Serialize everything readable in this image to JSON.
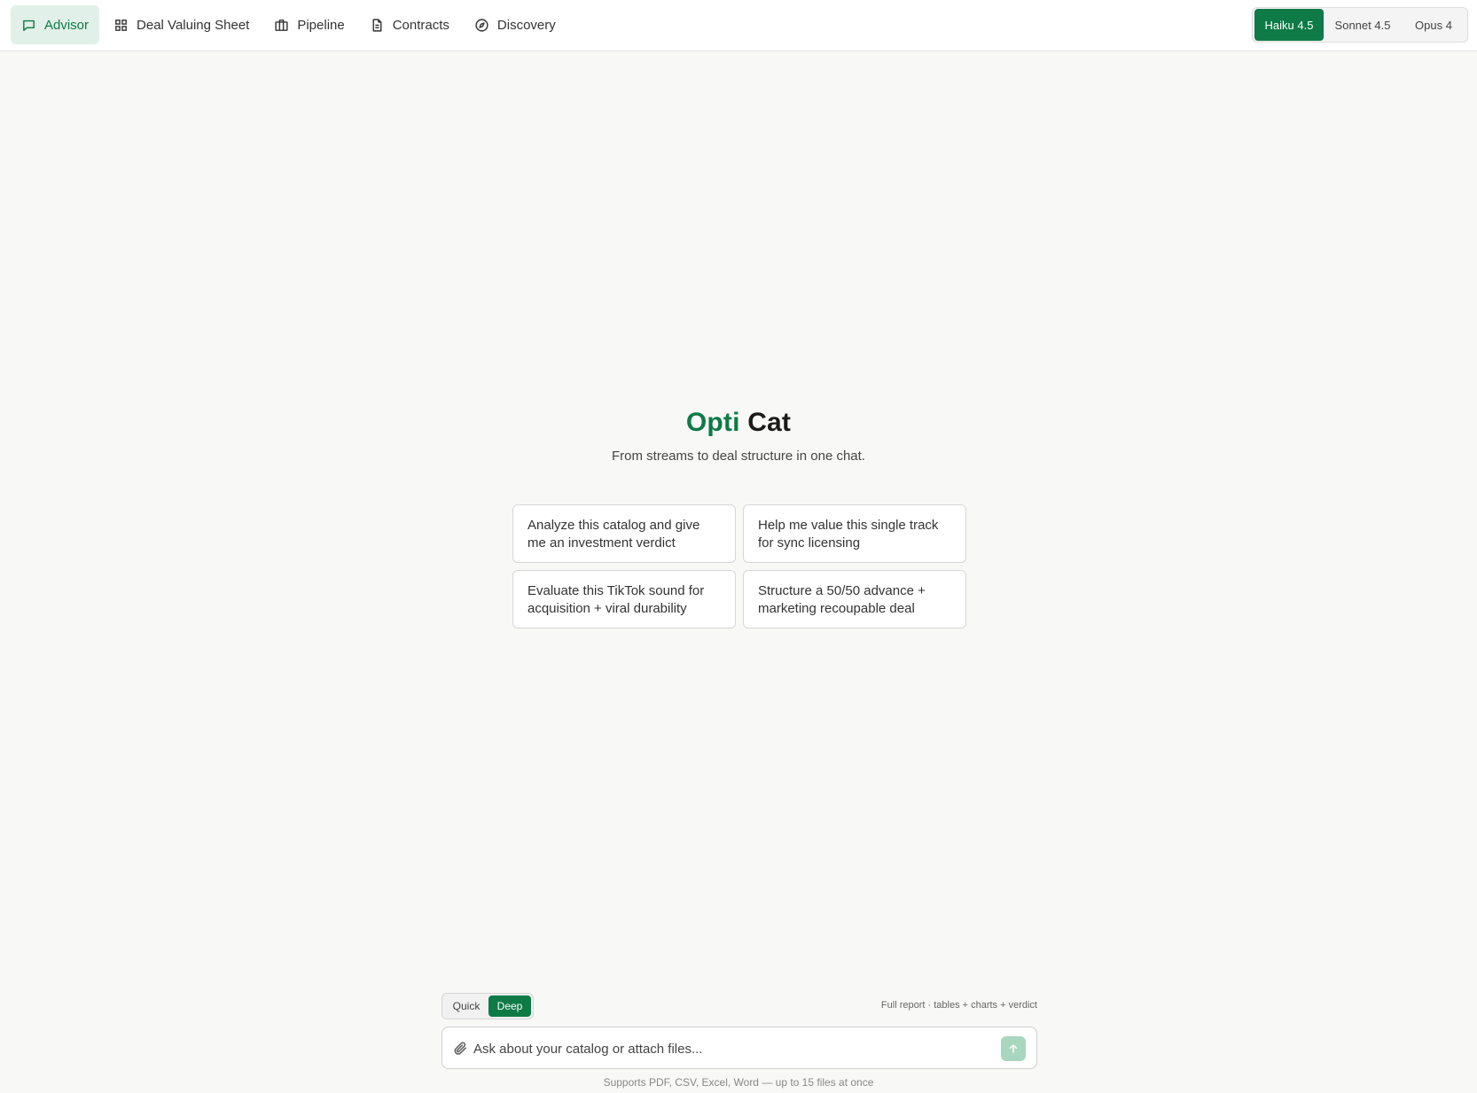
{
  "nav": {
    "items": [
      {
        "label": "Advisor",
        "icon": "chat-bubble-icon",
        "active": true
      },
      {
        "label": "Deal Valuing Sheet",
        "icon": "grid-icon"
      },
      {
        "label": "Pipeline",
        "icon": "briefcase-icon"
      },
      {
        "label": "Contracts",
        "icon": "document-icon"
      },
      {
        "label": "Discovery",
        "icon": "compass-icon"
      }
    ]
  },
  "models": {
    "options": [
      "Haiku 4.5",
      "Sonnet 4.5",
      "Opus 4"
    ],
    "selected": "Haiku 4.5"
  },
  "hero": {
    "brand_part1": "Opti",
    "brand_part2": "Cat",
    "tagline": "From streams to deal structure in one chat."
  },
  "suggestions": [
    "Analyze this catalog and give me an investment verdict",
    "Help me value this single track for sync licensing",
    "Evaluate this TikTok sound for acquisition + viral durability",
    "Structure a 50/50 advance + marketing recoupable deal"
  ],
  "mode": {
    "options": [
      "Quick",
      "Deep"
    ],
    "selected": "Deep",
    "hint": "Full report · tables + charts + verdict"
  },
  "composer": {
    "placeholder": "Ask about your catalog or attach files...",
    "footnote": "Supports PDF, CSV, Excel, Word — up to 15 files at once"
  },
  "colors": {
    "accent": "#0e7a46",
    "accent_soft": "#e1f0e8",
    "send_disabled": "#a9d6bf",
    "background": "#f8f8f7"
  }
}
